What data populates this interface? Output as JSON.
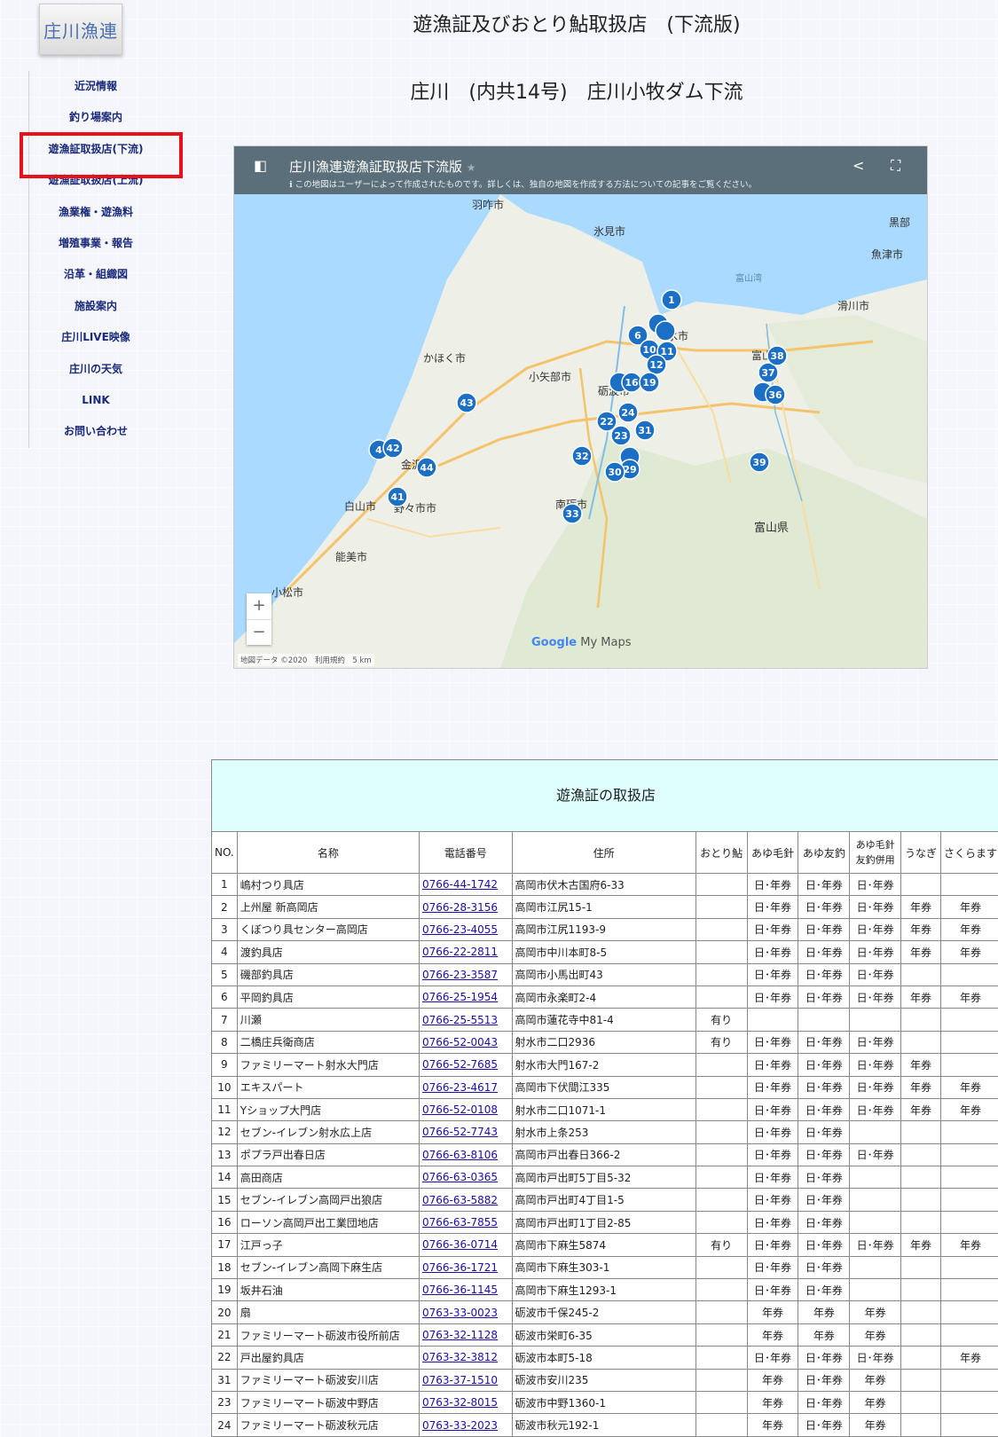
{
  "logo": "庄川漁連",
  "nav": [
    "近況情報",
    "釣り場案内",
    "遊漁証取扱店(下流)",
    "遊漁証取扱店(上流)",
    "漁業権・遊漁料",
    "増殖事業・報告",
    "沿革・組織図",
    "施設案内",
    "庄川LIVE映像",
    "庄川の天気",
    "LINK",
    "お問い合わせ"
  ],
  "title": "遊漁証及びおとり鮎取扱店　(下流版)",
  "subtitle": "庄川　(内共14号)　庄川小牧ダム下流",
  "map": {
    "title": "庄川漁連遊漁証取扱店下流版",
    "star": "★",
    "notice": "ℹ この地図はユーザーによって作成されたものです。詳しくは、独自の地図を作成する方法についての記事をご覧ください。",
    "share_icon": "share-icon",
    "brand_google": "Google",
    "brand_mymaps": "My Maps",
    "attribution": "地図データ ©2020　利用規約　5 km",
    "zoom_in": "+",
    "zoom_out": "−",
    "places": [
      "羽咋市",
      "氷見市",
      "黒部",
      "魚津市",
      "富山湾",
      "滑川市",
      "かほく市",
      "小矢部市",
      "水市",
      "富山",
      "白山市",
      "野々市市",
      "金沢市",
      "能美市",
      "小松市",
      "南砺市",
      "富山県",
      "砺波市"
    ],
    "markers": [
      "1",
      "6",
      "10",
      "11",
      "12",
      "16",
      "19",
      "22",
      "24",
      "23",
      "31",
      "32",
      "29",
      "30",
      "33",
      "37",
      "38",
      "36",
      "39",
      "41",
      "42",
      "43",
      "44",
      "4"
    ]
  },
  "table": {
    "caption": "遊漁証の取扱店",
    "headers": [
      "NO.",
      "名称",
      "電話番号",
      "住所",
      "おとり鮎",
      "あゆ毛針",
      "あゆ友釣",
      "あゆ毛針 友釣併用",
      "うなぎ",
      "さくらます"
    ],
    "rows": [
      [
        "1",
        "嶋村つり具店",
        "0766-44-1742",
        "高岡市伏木古国府6-33",
        "",
        "日･年券",
        "日･年券",
        "日･年券",
        "",
        ""
      ],
      [
        "2",
        "上州屋 新高岡店",
        "0766-28-3156",
        "高岡市江尻15-1",
        "",
        "日･年券",
        "日･年券",
        "日･年券",
        "年券",
        "年券"
      ],
      [
        "3",
        "くぼつり具センター高岡店",
        "0766-23-4055",
        "高岡市江尻1193-9",
        "",
        "日･年券",
        "日･年券",
        "日･年券",
        "年券",
        "年券"
      ],
      [
        "4",
        "渡釣具店",
        "0766-22-2811",
        "高岡市中川本町8-5",
        "",
        "日･年券",
        "日･年券",
        "日･年券",
        "年券",
        "年券"
      ],
      [
        "5",
        "磯部釣具店",
        "0766-23-3587",
        "高岡市小馬出町43",
        "",
        "日･年券",
        "日･年券",
        "日･年券",
        "",
        ""
      ],
      [
        "6",
        "平岡釣具店",
        "0766-25-1954",
        "高岡市永楽町2-4",
        "",
        "日･年券",
        "日･年券",
        "日･年券",
        "年券",
        "年券"
      ],
      [
        "7",
        "川瀬",
        "0766-25-5513",
        "高岡市蓮花寺中81-4",
        "有り",
        "",
        "",
        "",
        "",
        ""
      ],
      [
        "8",
        "二橋庄兵衛商店",
        "0766-52-0043",
        "射水市二口2936",
        "有り",
        "日･年券",
        "日･年券",
        "日･年券",
        "",
        ""
      ],
      [
        "9",
        "ファミリーマート射水大門店",
        "0766-52-7685",
        "射水市大門167-2",
        "",
        "日･年券",
        "日･年券",
        "日･年券",
        "年券",
        ""
      ],
      [
        "10",
        "エキスパート",
        "0766-23-4617",
        "高岡市下伏間江335",
        "",
        "日･年券",
        "日･年券",
        "日･年券",
        "年券",
        "年券"
      ],
      [
        "11",
        "Yショップ大門店",
        "0766-52-0108",
        "射水市二口1071-1",
        "",
        "日･年券",
        "日･年券",
        "日･年券",
        "年券",
        "年券"
      ],
      [
        "12",
        "セブン-イレブン射水広上店",
        "0766-52-7743",
        "射水市上条253",
        "",
        "日･年券",
        "日･年券",
        "",
        "",
        ""
      ],
      [
        "13",
        "ポプラ戸出春日店",
        "0766-63-8106",
        "高岡市戸出春日366-2",
        "",
        "日･年券",
        "日･年券",
        "日･年券",
        "",
        ""
      ],
      [
        "14",
        "高田商店",
        "0766-63-0365",
        "高岡市戸出町5丁目5-32",
        "",
        "日･年券",
        "日･年券",
        "",
        "",
        ""
      ],
      [
        "15",
        "セブン-イレブン高岡戸出狼店",
        "0766-63-5882",
        "高岡市戸出町4丁目1-5",
        "",
        "日･年券",
        "日･年券",
        "",
        "",
        ""
      ],
      [
        "16",
        "ローソン高岡戸出工業団地店",
        "0766-63-7855",
        "高岡市戸出町1丁目2-85",
        "",
        "日･年券",
        "日･年券",
        "",
        "",
        ""
      ],
      [
        "17",
        "江戸っ子",
        "0766-36-0714",
        "高岡市下麻生5874",
        "有り",
        "日･年券",
        "日･年券",
        "日･年券",
        "年券",
        "年券"
      ],
      [
        "18",
        "セブン-イレブン高岡下麻生店",
        "0766-36-1721",
        "高岡市下麻生303-1",
        "",
        "日･年券",
        "日･年券",
        "",
        "",
        ""
      ],
      [
        "19",
        "坂井石油",
        "0766-36-1145",
        "高岡市下麻生1293-1",
        "",
        "日･年券",
        "日･年券",
        "",
        "",
        ""
      ],
      [
        "20",
        "扇",
        "0763-33-0023",
        "砺波市千保245-2",
        "",
        "年券",
        "年券",
        "年券",
        "",
        ""
      ],
      [
        "21",
        "ファミリーマート砺波市役所前店",
        "0763-32-1128",
        "砺波市栄町6-35",
        "",
        "年券",
        "年券",
        "年券",
        "",
        ""
      ],
      [
        "22",
        "戸出屋釣具店",
        "0763-32-3812",
        "砺波市本町5-18",
        "",
        "日･年券",
        "日･年券",
        "日･年券",
        "",
        "年券"
      ],
      [
        "31",
        "ファミリーマート砺波安川店",
        "0763-37-1510",
        "砺波市安川235",
        "",
        "年券",
        "日･年券",
        "年券",
        "",
        ""
      ],
      [
        "23",
        "ファミリーマート砺波中野店",
        "0763-32-8015",
        "砺波市中野1360-1",
        "",
        "年券",
        "日･年券",
        "年券",
        "",
        ""
      ],
      [
        "24",
        "ファミリーマート砺波秋元店",
        "0763-33-2023",
        "砺波市秋元192-1",
        "",
        "年券",
        "日･年券",
        "年券",
        "",
        ""
      ]
    ]
  }
}
